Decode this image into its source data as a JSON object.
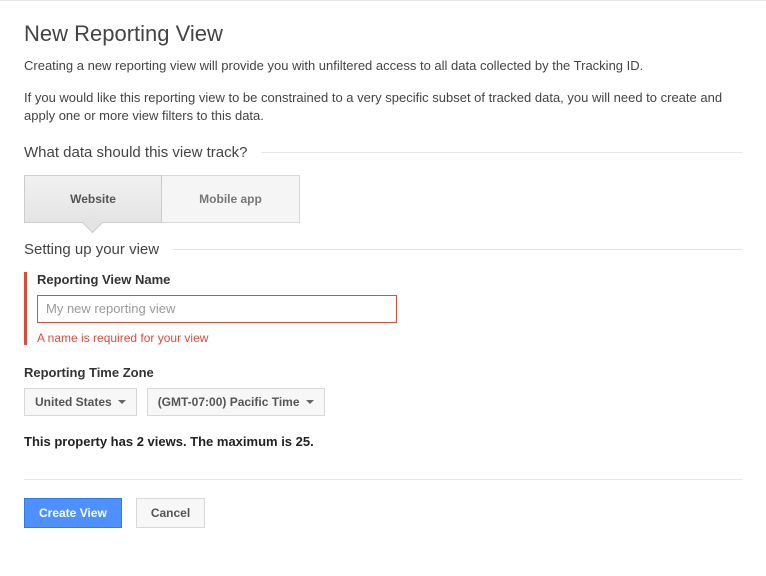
{
  "header": {
    "title": "New Reporting View",
    "desc1": "Creating a new reporting view will provide you with unfiltered access to all data collected by the Tracking ID.",
    "desc2": "If you would like this reporting view to be constrained to a very specific subset of tracked data, you will need to create and apply one or more view filters to this data."
  },
  "sections": {
    "track_question": "What data should this view track?",
    "tabs": {
      "website": "Website",
      "mobile": "Mobile app"
    },
    "setup_heading": "Setting up your view"
  },
  "view_name": {
    "label": "Reporting View Name",
    "placeholder": "My new reporting view",
    "value": "",
    "error": "A name is required for your view"
  },
  "timezone": {
    "label": "Reporting Time Zone",
    "country": "United States",
    "zone": "(GMT-07:00) Pacific Time"
  },
  "limit": "This property has 2 views. The maximum is 25.",
  "footer": {
    "create": "Create View",
    "cancel": "Cancel"
  }
}
